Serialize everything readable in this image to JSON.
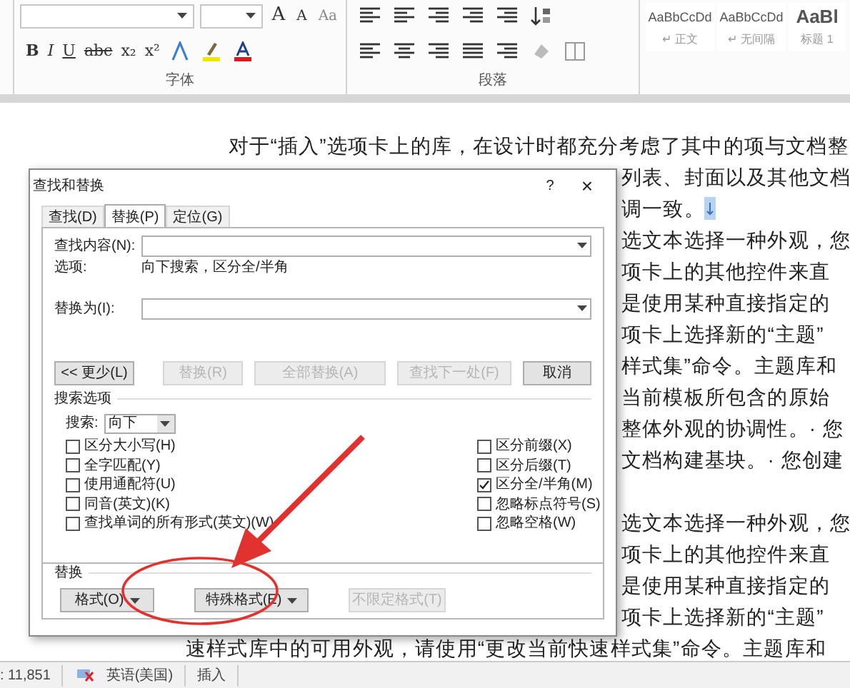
{
  "ribbon": {
    "font_group": {
      "label": "字体",
      "row1_text_buttons": [
        "A",
        "A",
        "Aa"
      ],
      "row2_text_buttons": [
        "B",
        "I",
        "U",
        "abc",
        "x₂",
        "x²"
      ]
    },
    "paragraph_group": {
      "label": "段落"
    },
    "styles": [
      {
        "preview": "AaBbCcDd",
        "name": "↵ 正文"
      },
      {
        "preview": "AaBbCcDd",
        "name": "↵ 无间隔"
      },
      {
        "preview": "AaBl",
        "name": "标题 1"
      }
    ]
  },
  "document": {
    "lines": [
      {
        "kind": "full",
        "text": "对于“插入”选项卡上的库，在设计时都充分考虑了其中的项与文档整"
      },
      {
        "kind": "tail",
        "text": "列表、封面以及其他文档"
      },
      {
        "kind": "tail",
        "text": "调一致。",
        "paragraph_mark": true
      },
      {
        "kind": "tail",
        "text": "选文本选择一种外观，您"
      },
      {
        "kind": "tail",
        "text": "项卡上的其他控件来直"
      },
      {
        "kind": "tail",
        "text": "是使用某种直接指定的"
      },
      {
        "kind": "tail",
        "text": "项卡上选择新的“主题”"
      },
      {
        "kind": "tail",
        "text": "样式集”命令。主题库和"
      },
      {
        "kind": "tail",
        "text": "当前模板所包含的原始"
      },
      {
        "kind": "tail",
        "text": "整体外观的协调性。· 您"
      },
      {
        "kind": "tail",
        "text": "文档构建基块。· 您创建"
      },
      {
        "kind": "blank"
      },
      {
        "kind": "tail",
        "text": "选文本选择一种外观，您"
      },
      {
        "kind": "tail",
        "text": "项卡上的其他控件来直"
      },
      {
        "kind": "tail",
        "text": "是使用某种直接指定的"
      },
      {
        "kind": "tail",
        "text": "项卡上选择新的“主题”"
      },
      {
        "kind": "continued",
        "text": "速样式库中的可用外观，请使用“更改当前快速样式集”命令。主题库和"
      }
    ]
  },
  "dialog": {
    "title": "查找和替换",
    "help": "?",
    "close": "×",
    "tabs": [
      {
        "label": "查找(D)",
        "selected": false
      },
      {
        "label": "替换(P)",
        "selected": true
      },
      {
        "label": "定位(G)",
        "selected": false
      }
    ],
    "find_label": "查找内容(N):",
    "options_label": "选项:",
    "options_value": "向下搜索，区分全/半角",
    "replace_label": "替换为(I):",
    "buttons": [
      {
        "label": "<< 更少(L)",
        "disabled": false
      },
      {
        "label": "替换(R)",
        "disabled": true
      },
      {
        "label": "全部替换(A)",
        "disabled": true
      },
      {
        "label": "查找下一处(F)",
        "disabled": true
      },
      {
        "label": "取消",
        "disabled": false
      }
    ],
    "search_options_title": "搜索选项",
    "search_label": "搜索:",
    "search_direction": "向下",
    "left_checks": [
      {
        "label": "区分大小写(H)",
        "checked": false
      },
      {
        "label": "全字匹配(Y)",
        "checked": false
      },
      {
        "label": "使用通配符(U)",
        "checked": false
      },
      {
        "label": "同音(英文)(K)",
        "checked": false
      },
      {
        "label": "查找单词的所有形式(英文)(W)",
        "checked": false
      }
    ],
    "right_checks": [
      {
        "label": "区分前缀(X)",
        "checked": false
      },
      {
        "label": "区分后缀(T)",
        "checked": false
      },
      {
        "label": "区分全/半角(M)",
        "checked": true
      },
      {
        "label": "忽略标点符号(S)",
        "checked": false
      },
      {
        "label": "忽略空格(W)",
        "checked": false
      }
    ],
    "replace_section_title": "替换",
    "format_buttons": [
      {
        "label": "格式(O)",
        "disabled": false,
        "dropdown": true
      },
      {
        "label": "特殊格式(E)",
        "disabled": false,
        "dropdown": true
      },
      {
        "label": "不限定格式(T)",
        "disabled": true,
        "dropdown": false
      }
    ]
  },
  "status_bar": {
    "word_count": ": 11,851",
    "language": "英语(美国)",
    "mode": "插入"
  }
}
